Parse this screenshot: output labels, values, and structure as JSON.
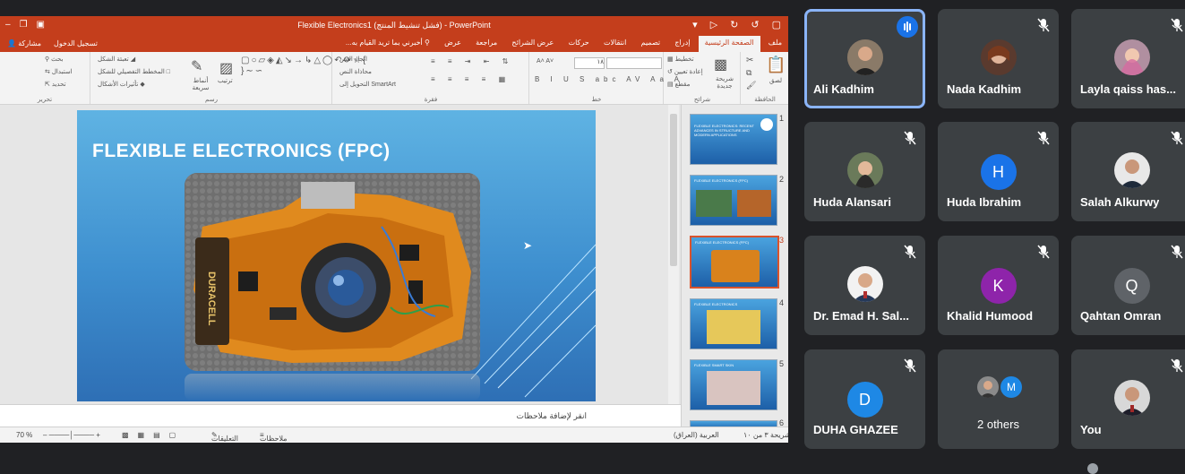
{
  "ppt": {
    "window_title": "Flexible Electronics1 (فشل تنشيط المنتج) - PowerPoint",
    "share_label": "مشاركة",
    "signin_label": "تسجيل الدخول",
    "tell_me": "أخبرني بما تريد القيام به...",
    "tabs": [
      "ملف",
      "الصفحة الرئيسية",
      "إدراج",
      "تصميم",
      "انتقالات",
      "حركات",
      "عرض الشرائح",
      "مراجعة",
      "عرض"
    ],
    "ribbon": {
      "paste": "لصق",
      "new_slide": "شريحة جديدة",
      "layout": "تخطيط",
      "reset": "إعادة تعيين",
      "section": "مقطع",
      "clipboard_group": "الحافظة",
      "slides_group": "شرائح",
      "font_group": "خط",
      "paragraph_group": "فقرة",
      "text_direction": "اتجاه النص",
      "align_text": "محاذاة النص",
      "convert_smartart": "التحويل إلى SmartArt",
      "arrange": "ترتيب",
      "quick_styles": "أنماط سريعة",
      "drawing_group": "رسم",
      "shape_fill": "تعبئة الشكل",
      "shape_outline": "المخطط التفصيلي للشكل",
      "shape_effects": "تأثيرات الأشكال",
      "find": "بحث",
      "replace": "استبدال",
      "select": "تحديد",
      "editing_group": "تحرير",
      "font_size": "١٨"
    },
    "slide": {
      "title": "FLEXIBLE ELECTRONICS (FPC)",
      "battery_text": "DURACELL"
    },
    "notes_placeholder": "انقر لإضافة ملاحظات",
    "thumbnails": [
      {
        "num": "1",
        "caption": "FLEXIBLE ELECTRONICS: RECENT ADVANCES IN STRUCTURE AND MODERN APPLICATIONS"
      },
      {
        "num": "2",
        "caption": "FLEXIBLE ELECTRONICS (FPC)"
      },
      {
        "num": "3",
        "caption": "FLEXIBLE ELECTRONICS (FPC)"
      },
      {
        "num": "4",
        "caption": "FLEXIBLE ELECTRONICS"
      },
      {
        "num": "5",
        "caption": "FLEXIBLE SMART SKIN"
      },
      {
        "num": "6",
        "caption": ""
      }
    ],
    "selected_thumbnail": 3,
    "status": {
      "slide_count": "شريحة ٣ من ١٠",
      "language": "العربية (العراق)",
      "notes": "ملاحظات",
      "comments": "التعليقات",
      "zoom": "70 %"
    }
  },
  "meet": {
    "participants": [
      {
        "name": "Ali Kadhim",
        "type": "photo",
        "speaking": true
      },
      {
        "name": "Nada Kadhim",
        "type": "photo",
        "muted": true
      },
      {
        "name": "Layla qaiss has...",
        "type": "photo",
        "muted": true
      },
      {
        "name": "Huda Alansari",
        "type": "photo",
        "muted": true
      },
      {
        "name": "Huda Ibrahim",
        "type": "initial",
        "initial": "H",
        "color": "#1a73e8",
        "muted": true
      },
      {
        "name": "Salah Alkurwy",
        "type": "photo",
        "muted": true
      },
      {
        "name": "Dr. Emad H. Sal...",
        "type": "photo",
        "muted": true
      },
      {
        "name": "Khalid Humood",
        "type": "initial",
        "initial": "K",
        "color": "#8e24aa",
        "muted": true
      },
      {
        "name": "Qahtan Omran",
        "type": "initial",
        "initial": "Q",
        "color": "#5f6368",
        "muted": true
      },
      {
        "name": "DUHA GHAZEE",
        "type": "initial",
        "initial": "D",
        "color": "#1e88e5",
        "muted": true
      },
      {
        "name": "2 others",
        "type": "others",
        "initial": "M",
        "color": "#1e88e5"
      },
      {
        "name": "You",
        "type": "photo",
        "muted": true
      }
    ]
  },
  "colors": {
    "ppt_accent": "#c43e1c",
    "meet_bg": "#202124",
    "tile_bg": "#3c4043",
    "active_border": "#8ab4f8"
  }
}
